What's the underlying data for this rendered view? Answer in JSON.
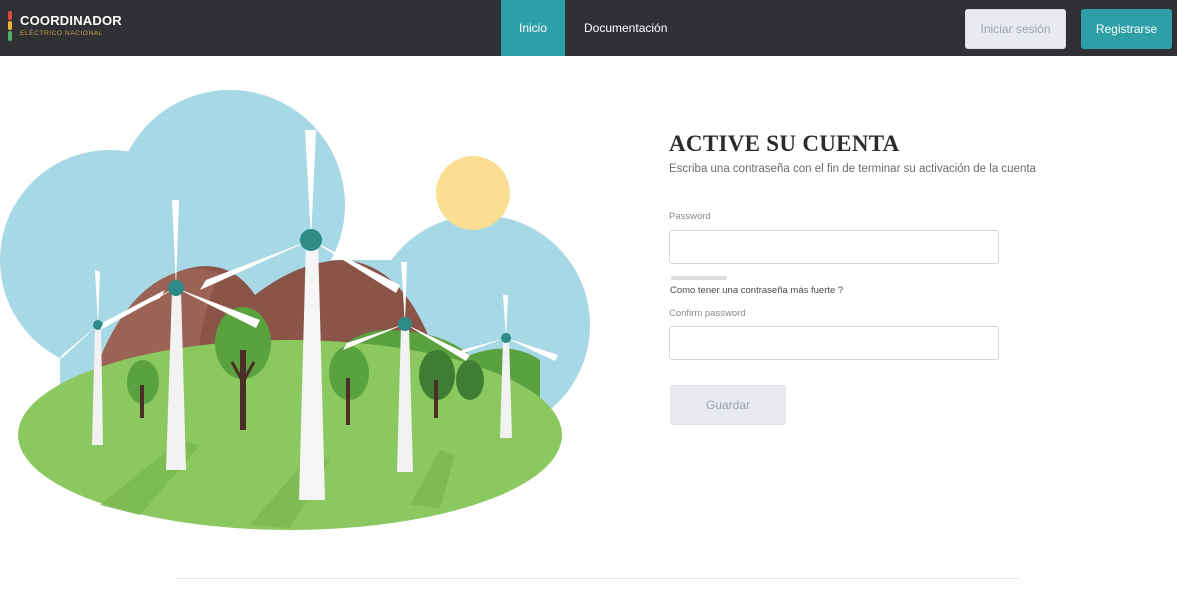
{
  "brand": {
    "name": "COORDINADOR",
    "sub": "ELÉCTRICO NACIONAL"
  },
  "nav": {
    "items": [
      {
        "label": "Inicio"
      },
      {
        "label": "Documentación"
      }
    ],
    "login_label": "Iniciar sesión",
    "register_label": "Registrarse"
  },
  "form": {
    "title": "ACTIVE SU CUENTA",
    "subtitle": "Escriba una contraseña con el fin de terminar su activación de la cuenta",
    "password_label": "Password",
    "password_value": "",
    "strength_link": "Como tener una contraseña más fuerte ?",
    "confirm_label": "Confirm password",
    "confirm_value": "",
    "save_label": "Guardar"
  },
  "colors": {
    "accent": "#2e9ea7",
    "navbar": "#2f3135"
  },
  "illustration": {
    "subject": "wind-turbines-landscape"
  }
}
